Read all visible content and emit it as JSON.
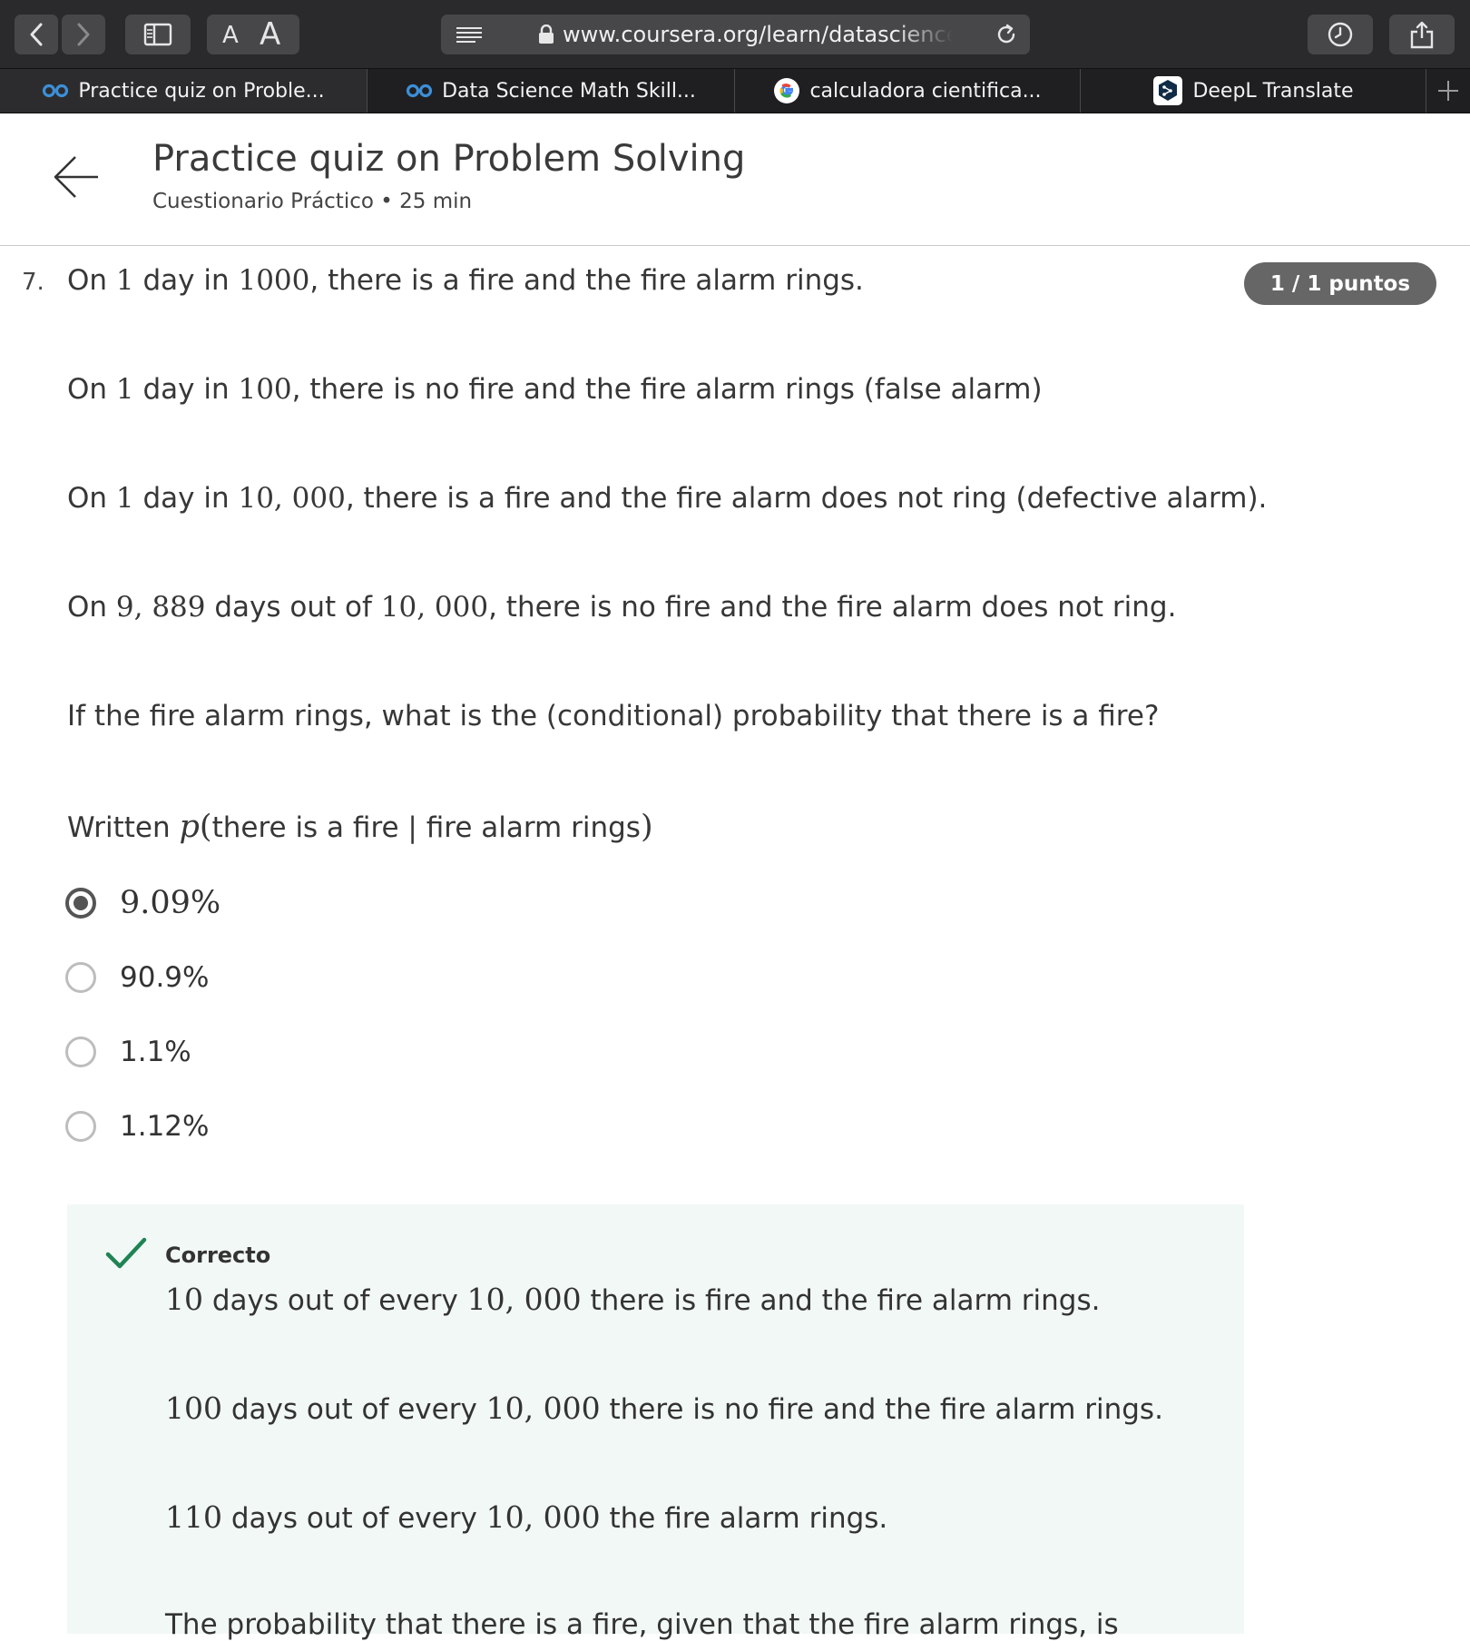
{
  "browser": {
    "url": "www.coursera.org/learn/datasciencemat",
    "tabs": [
      {
        "label": "Practice quiz on Proble...",
        "icon": "coursera-icon"
      },
      {
        "label": "Data Science Math Skill...",
        "icon": "coursera-icon"
      },
      {
        "label": "calculadora cientifica...",
        "icon": "google-icon"
      },
      {
        "label": "DeepL Translate",
        "icon": "deepl-icon"
      }
    ],
    "text_size_small": "A",
    "text_size_large": "A"
  },
  "header": {
    "title": "Practice quiz on Problem Solving",
    "subtitle": "Cuestionario Práctico • 25 min"
  },
  "question": {
    "number": "7.",
    "points": "1 / 1 puntos",
    "lines": {
      "l1": {
        "a": "On ",
        "n1": "1",
        "b": " day in ",
        "n2": "1000",
        "c": ", there is a fire and the fire alarm rings."
      },
      "l2": {
        "a": "On ",
        "n1": "1",
        "b": " day in ",
        "n2": "100",
        "c": ", there is no fire and the fire alarm rings (false alarm)"
      },
      "l3": {
        "a": "On ",
        "n1": "1",
        "b": " day in ",
        "n2": "10, 000",
        "c": ", there is a fire and the fire alarm does not ring (defective alarm)."
      },
      "l4": {
        "a": "On ",
        "n1": "9, 889",
        "b": " days out of ",
        "n2": "10, 000",
        "c": ", there is no fire and the fire alarm does not ring."
      },
      "l5": "If the fire alarm rings, what is the (conditional) probability that there is a fire?",
      "l6": {
        "a": "Written ",
        "p": "p",
        "paren_open": "(",
        "b": "there is a fire | fire alarm rings",
        "paren_close": ")"
      }
    },
    "options": [
      {
        "label": "9.09%",
        "selected": true
      },
      {
        "label": "90.9%",
        "selected": false
      },
      {
        "label": "1.1%",
        "selected": false
      },
      {
        "label": "1.12%",
        "selected": false
      }
    ]
  },
  "feedback": {
    "status": "Correcto",
    "lines": {
      "f1": {
        "n1": "10",
        "a": " days out of every ",
        "n2": "10, 000",
        "b": " there is fire and the fire alarm rings."
      },
      "f2": {
        "n1": "100",
        "a": " days out of every ",
        "n2": "10, 000",
        "b": " there is no fire and the fire alarm rings."
      },
      "f3": {
        "n1": "110",
        "a": " days out of every ",
        "n2": "10, 000",
        "b": " the fire alarm rings."
      },
      "f4": "The probability that there is a fire, given that the fire alarm rings, is"
    }
  }
}
